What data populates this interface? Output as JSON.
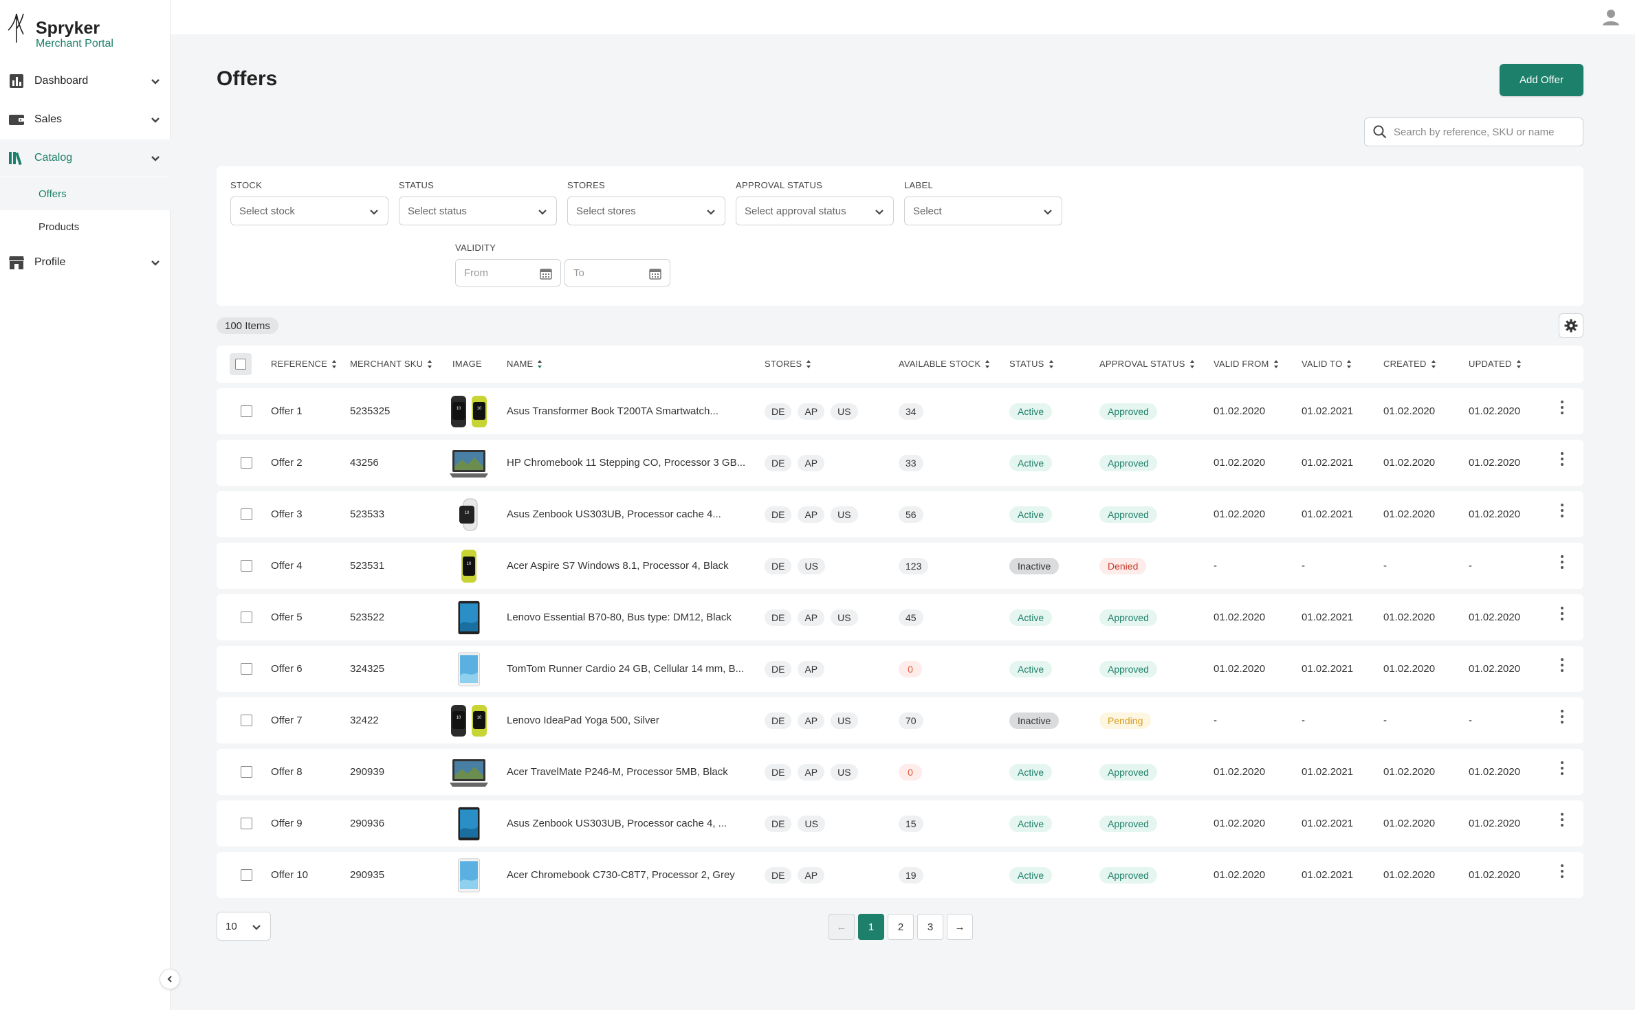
{
  "brand": {
    "name": "Spryker",
    "subtitle": "Merchant Portal"
  },
  "sidebar": {
    "items": [
      {
        "label": "Dashboard",
        "icon": "dashboard-icon"
      },
      {
        "label": "Sales",
        "icon": "wallet-icon"
      },
      {
        "label": "Catalog",
        "icon": "catalog-icon",
        "active": true
      },
      {
        "label": "Profile",
        "icon": "store-icon"
      }
    ],
    "subitems": [
      {
        "label": "Offers",
        "active": true
      },
      {
        "label": "Products"
      }
    ]
  },
  "page": {
    "title": "Offers",
    "add_button": "Add Offer"
  },
  "search": {
    "placeholder": "Search by reference, SKU or name"
  },
  "filters": {
    "stock": {
      "label": "STOCK",
      "placeholder": "Select stock"
    },
    "status": {
      "label": "STATUS",
      "placeholder": "Select status"
    },
    "stores": {
      "label": "STORES",
      "placeholder": "Select stores"
    },
    "approval": {
      "label": "APPROVAL STATUS",
      "placeholder": "Select approval status"
    },
    "label": {
      "label": "LABEL",
      "placeholder": "Select"
    },
    "validity": {
      "label": "VALIDITY",
      "from": "From",
      "to": "To"
    }
  },
  "table": {
    "count": "100 Items",
    "columns": {
      "reference": "REFERENCE",
      "merchant_sku": "MERCHANT SKU",
      "image": "IMAGE",
      "name": "NAME",
      "stores": "STORES",
      "available_stock": "AVAILABLE STOCK",
      "status": "STATUS",
      "approval_status": "APPROVAL STATUS",
      "valid_from": "VALID FROM",
      "valid_to": "VALID TO",
      "created": "CREATED",
      "updated": "UPDATED"
    },
    "rows": [
      {
        "reference": "Offer 1",
        "sku": "5235325",
        "image": "watch-pair",
        "name": "Asus Transformer Book T200TA Smartwatch...",
        "stores": [
          "DE",
          "AP",
          "US"
        ],
        "stock": "34",
        "status": "Active",
        "approval": "Approved",
        "valid_from": "01.02.2020",
        "valid_to": "01.02.2021",
        "created": "01.02.2020",
        "updated": "01.02.2020"
      },
      {
        "reference": "Offer 2",
        "sku": "43256",
        "image": "laptop",
        "name": "HP Chromebook 11 Stepping CO, Processor 3 GB...",
        "stores": [
          "DE",
          "AP"
        ],
        "stock": "33",
        "status": "Active",
        "approval": "Approved",
        "valid_from": "01.02.2020",
        "valid_to": "01.02.2021",
        "created": "01.02.2020",
        "updated": "01.02.2020"
      },
      {
        "reference": "Offer 3",
        "sku": "523533",
        "image": "watch-white",
        "name": "Asus Zenbook US303UB, Processor cache 4...",
        "stores": [
          "DE",
          "AP",
          "US"
        ],
        "stock": "56",
        "status": "Active",
        "approval": "Approved",
        "valid_from": "01.02.2020",
        "valid_to": "01.02.2021",
        "created": "01.02.2020",
        "updated": "01.02.2020"
      },
      {
        "reference": "Offer 4",
        "sku": "523531",
        "image": "watch-yellow",
        "name": "Acer Aspire S7 Windows 8.1, Processor 4, Black",
        "stores": [
          "DE",
          "US"
        ],
        "stock": "123",
        "status": "Inactive",
        "approval": "Denied",
        "valid_from": "-",
        "valid_to": "-",
        "created": "-",
        "updated": "-"
      },
      {
        "reference": "Offer 5",
        "sku": "523522",
        "image": "tablet-dark",
        "name": "Lenovo Essential B70-80, Bus type: DM12, Black",
        "stores": [
          "DE",
          "AP",
          "US"
        ],
        "stock": "45",
        "status": "Active",
        "approval": "Approved",
        "valid_from": "01.02.2020",
        "valid_to": "01.02.2021",
        "created": "01.02.2020",
        "updated": "01.02.2020"
      },
      {
        "reference": "Offer 6",
        "sku": "324325",
        "image": "tablet-light",
        "name": "TomTom Runner Cardio 24 GB, Cellular 14 mm, B...",
        "stores": [
          "DE",
          "AP"
        ],
        "stock": "0",
        "status": "Active",
        "approval": "Approved",
        "valid_from": "01.02.2020",
        "valid_to": "01.02.2021",
        "created": "01.02.2020",
        "updated": "01.02.2020"
      },
      {
        "reference": "Offer 7",
        "sku": "32422",
        "image": "watch-pair",
        "name": "Lenovo IdeaPad Yoga 500,  Silver",
        "stores": [
          "DE",
          "AP",
          "US"
        ],
        "stock": "70",
        "status": "Inactive",
        "approval": "Pending",
        "valid_from": "-",
        "valid_to": "-",
        "created": "-",
        "updated": "-"
      },
      {
        "reference": "Offer 8",
        "sku": "290939",
        "image": "laptop",
        "name": "Acer TravelMate P246-M, Processor 5MB, Black",
        "stores": [
          "DE",
          "AP",
          "US"
        ],
        "stock": "0",
        "status": "Active",
        "approval": "Approved",
        "valid_from": "01.02.2020",
        "valid_to": "01.02.2021",
        "created": "01.02.2020",
        "updated": "01.02.2020"
      },
      {
        "reference": "Offer 9",
        "sku": "290936",
        "image": "tablet-dark",
        "name": "Asus Zenbook US303UB, Processor cache 4, ...",
        "stores": [
          "DE",
          "US"
        ],
        "stock": "15",
        "status": "Active",
        "approval": "Approved",
        "valid_from": "01.02.2020",
        "valid_to": "01.02.2021",
        "created": "01.02.2020",
        "updated": "01.02.2020"
      },
      {
        "reference": "Offer 10",
        "sku": "290935",
        "image": "tablet-light",
        "name": "Acer Chromebook C730-C8T7, Processor 2, Grey",
        "stores": [
          "DE",
          "AP"
        ],
        "stock": "19",
        "status": "Active",
        "approval": "Approved",
        "valid_from": "01.02.2020",
        "valid_to": "01.02.2021",
        "created": "01.02.2020",
        "updated": "01.02.2020"
      }
    ]
  },
  "pagination": {
    "page_size": "10",
    "pages": [
      "1",
      "2",
      "3"
    ],
    "current": "1",
    "prev": "←",
    "next": "→"
  },
  "colors": {
    "accent": "#1d806a",
    "active_bg": "#e5f5ef",
    "denied": "#c73a2c",
    "pending": "#d89b1c",
    "zero_stock": "#e05a3a"
  }
}
